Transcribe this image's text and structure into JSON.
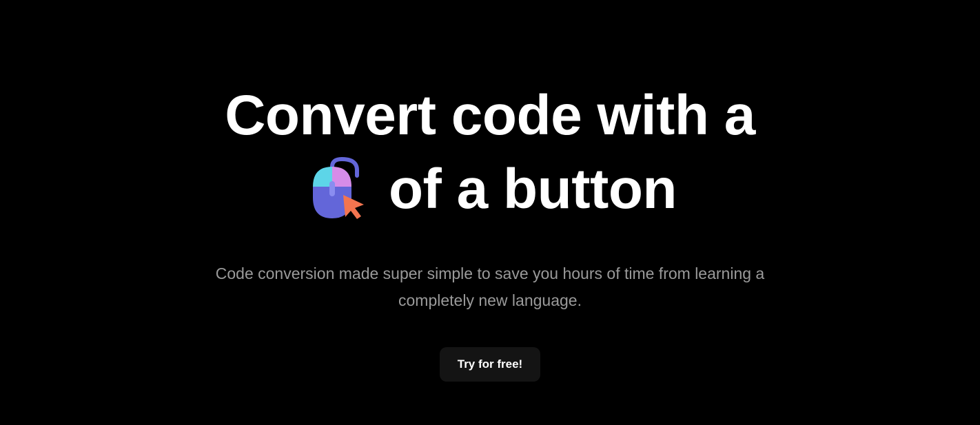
{
  "hero": {
    "title_line1": "Convert code with a",
    "title_line2": "of a button",
    "subtitle": "Code conversion made super simple to save you hours of time from learning a completely new language.",
    "cta_label": "Try for free!",
    "icon_name": "mouse-click-icon"
  },
  "colors": {
    "background": "#000000",
    "text_primary": "#ffffff",
    "text_secondary": "#9a9a9a",
    "button_bg": "#141414",
    "icon_blue": "#6366d9",
    "icon_cyan": "#5dd5e8",
    "icon_pink": "#d68ce8",
    "icon_orange": "#f37550"
  }
}
